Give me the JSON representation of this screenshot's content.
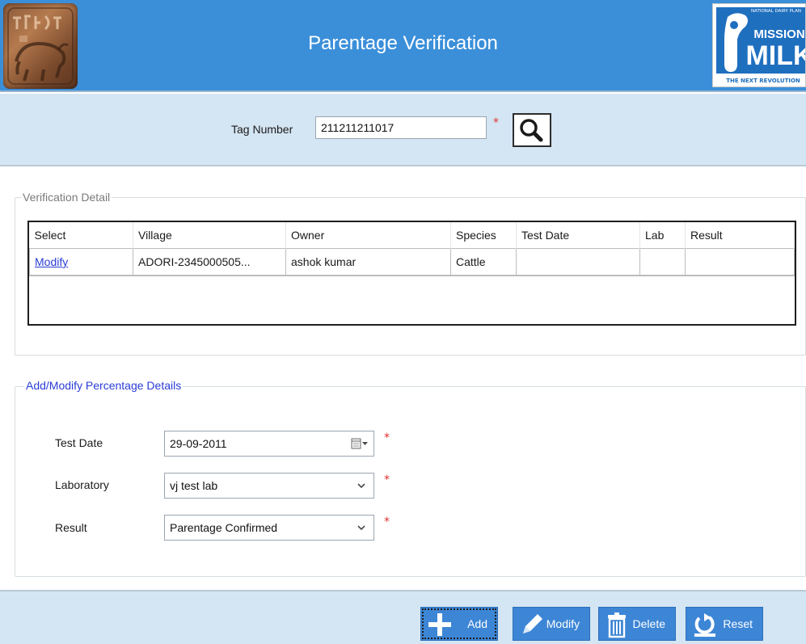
{
  "header": {
    "title": "Parentage Verification",
    "logo_right": {
      "top_text": "NATIONAL DAIRY PLAN",
      "line1": "MISSION",
      "line2": "MILK",
      "tagline": "THE NEXT REVOLUTION"
    }
  },
  "search": {
    "label": "Tag Number",
    "value": "211211211017",
    "required_mark": "*"
  },
  "verification": {
    "legend": "Verification Detail",
    "columns": [
      "Select",
      "Village",
      "Owner",
      "Species",
      "Test Date",
      "Lab",
      "Result"
    ],
    "rows": [
      {
        "select": "Modify",
        "village": "ADORI-2345000505...",
        "owner": "ashok kumar",
        "species": "Cattle",
        "test_date": "",
        "lab": "",
        "result": ""
      }
    ]
  },
  "form": {
    "legend": "Add/Modify Percentage Details",
    "test_date": {
      "label": "Test Date",
      "value": "29-09-2011"
    },
    "laboratory": {
      "label": "Laboratory",
      "value": "vj test lab"
    },
    "result": {
      "label": "Result",
      "value": "Parentage Confirmed"
    },
    "required_mark": "*"
  },
  "toolbar": {
    "add": "Add",
    "modify": "Modify",
    "delete": "Delete",
    "reset": "Reset"
  },
  "colors": {
    "header_bg": "#3b8fd9",
    "panel_bg": "#d4e5f3",
    "button_bg": "#3d86d6",
    "link": "#2a3cd6",
    "required": "#e03030"
  }
}
